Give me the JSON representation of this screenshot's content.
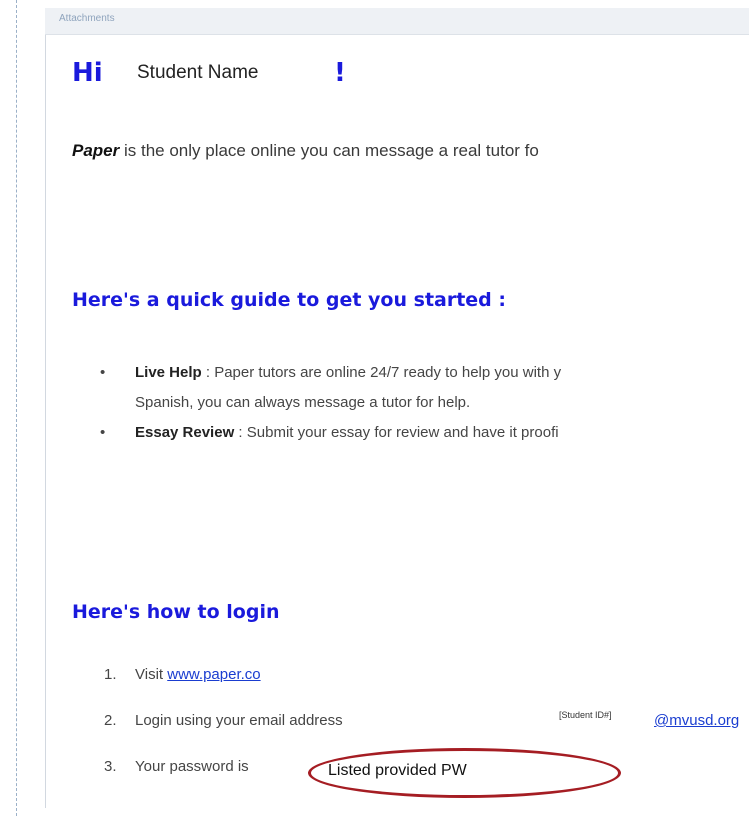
{
  "attachments": {
    "label": "Attachments"
  },
  "greeting": {
    "hi": "Hi",
    "name": "Student Name",
    "exclaim": "!"
  },
  "intro": {
    "brand": "Paper",
    "text": " is the only place online you can message a real tutor fo"
  },
  "guide": {
    "heading": "Here's a quick guide to get you started :",
    "bullet_glyph": "•",
    "items": [
      {
        "term": "Live Help",
        "sep": " : ",
        "line1": "Paper tutors are online 24/7 ready to help you with y",
        "line2": "Spanish, you can always message a tutor for help."
      },
      {
        "term": "Essay Review",
        "sep": " : ",
        "line1": "Submit your essay for review and have it proofi",
        "line2": ""
      }
    ]
  },
  "login": {
    "heading": "Here's how to login",
    "steps": [
      {
        "num": "1.",
        "text": "Visit ",
        "link": "www.paper.co"
      },
      {
        "num": "2.",
        "text": "Login using your email address",
        "placeholder": "[Student ID#]",
        "domain": "@mvusd.org"
      },
      {
        "num": "3.",
        "text": "Your password is",
        "value": "Listed provided PW"
      }
    ]
  },
  "colors": {
    "heading_blue": "#1a1adc",
    "link_blue": "#1a3dd0",
    "ring_red": "#a51d23"
  }
}
